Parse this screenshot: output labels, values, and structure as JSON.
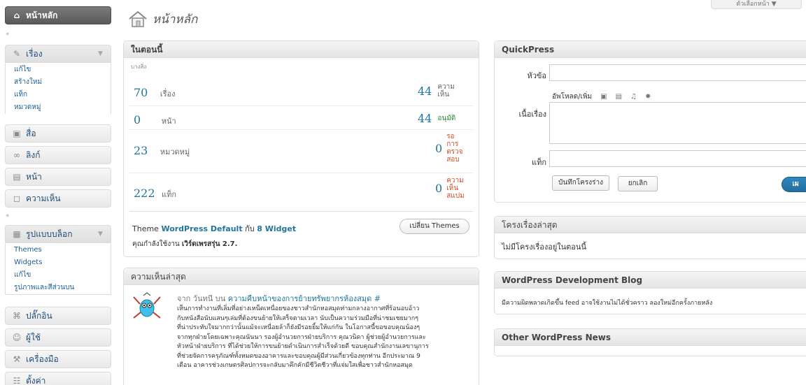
{
  "sidebar": {
    "dashboard": "หน้าหลัก",
    "posts": "เรื่อง",
    "posts_sub": [
      "แก้ไข",
      "สร้างใหม่",
      "แท็ก",
      "หมวดหมู่"
    ],
    "media": "สื่อ",
    "links": "ลิงก์",
    "pages": "หน้า",
    "comments": "ความเห็น",
    "appearance": "รูปแบบบล็อก",
    "appearance_sub": [
      "Themes",
      "Widgets",
      "แก้ไข",
      "รูปภาพและสีส่วนบน"
    ],
    "plugins": "ปลั๊กอิน",
    "users": "ผู้ใช้",
    "tools": "เครื่องมือ",
    "settings": "ตั้งค่า",
    "separator": "«"
  },
  "header": {
    "title": "หน้าหลัก",
    "screen_options": "ตัวเลือกหน้า"
  },
  "right_now": {
    "title": "ในตอนนี้",
    "subtitle": "บางสิ่ง",
    "rows": [
      {
        "left_num": "70",
        "left_label": "เรื่อง",
        "right_num": "44",
        "right_label": "ความเห็น"
      },
      {
        "left_num": "0",
        "left_label": "หน้า",
        "right_num": "44",
        "right_label": "อนุมัติ"
      },
      {
        "left_num": "23",
        "left_label": "หมวดหมู่",
        "right_num": "0",
        "right_label": "รอการตรวจสอบ"
      },
      {
        "left_num": "222",
        "left_label": "แท็ก",
        "right_num": "0",
        "right_label": "ความเห็นสแปม"
      }
    ],
    "theme_prefix": "Theme",
    "theme_name": "WordPress Default",
    "theme_mid": "กับ",
    "widget_count": "8 Widget",
    "change_theme": "เปลี่ยน Themes",
    "version_prefix": "คุณกำลังใช้งาน",
    "version_name": "เวิร์ดเพรสรุ่น 2.7."
  },
  "recent_comments": {
    "title": "ความเห็นล่าสุด",
    "from": "จาก",
    "author": "วันทนี",
    "on": "บน",
    "post": "ความคืบหน้าของการย้ายทรัพยากรห้องสมุด #",
    "lines": [
      "เห็นการทำงานที่เลิ่มที่อย่างเหน็ดเหนื่อยของชาวสำนักหอสมุดท่ามกลางอากาศที่ร้อนอบอ้าว",
      "กับหนังสือนับแสนๆเล่มที่ต้องขนย้ายให้เสร็จตามเวลา นับเป็นความร่วมมือที่น่าชมเชยมากๆ",
      "ที่น่าประทับใจมากกว่านั้นแม้จะเหนื่อยล้าก็ยังมีรอยยิ้มให้แก่กัน ในโอกาสนี้ขอขอบคุณน้องๆ",
      "จากทุกฝ่ายโดยเฉพาะคุณนันนา รองผู้อำนวยการฝ่ายบริการ คุณวนิดา ผู้ช่วยผู้อำนวยการและ",
      "หัวหน้าฝ่ายบริการ ที่ได้ช่วยให้การขนย้ายดำเนินการสำเร็จด้วยดี ขอบคุณสำนักงานเลขานุการ",
      "ที่ช่วยจัดการครุภัณฑ์ทั้งหมดของอาคารและขอบคุณผู้มีส่วนเกี่ยวข้องทุกท่าน อีกประมาณ 9",
      "เดือน อาคารช่วงเกษตรศิลปการจะกลับมาคึกคักมีชีวิตชีวาที่แจ่มใสเพื่อชาวสำนักหอสมุด"
    ]
  },
  "quickpress": {
    "title": "QuickPress",
    "label_title": "หัวข้อ",
    "upload_label": "อัพโหลด/เพิ่ม",
    "label_content": "เนื้อเรื่อง",
    "label_tags": "แท็ก",
    "save_draft": "บันทึกโครงร่าง",
    "cancel": "ยกเลิก",
    "publish": "เผ"
  },
  "recent_drafts": {
    "title": "โครงเรื่องล่าสุด",
    "empty": "ไม่มีโครงเรื่องอยู่ในตอนนี้"
  },
  "dev_blog": {
    "title": "WordPress Development Blog",
    "message": "มีความผิดพลาดเกิดขึ้น feed อาจใช้งานไม่ได้ชั่วคราว ลองใหม่อีกครั้งภายหลัง"
  },
  "other_news": {
    "title": "Other WordPress News"
  }
}
